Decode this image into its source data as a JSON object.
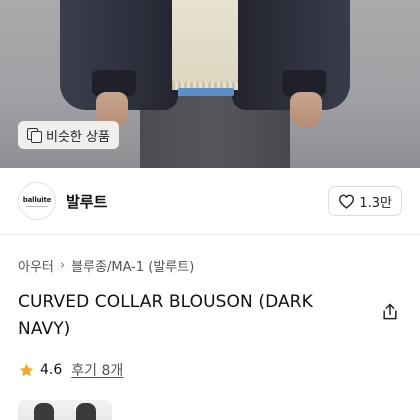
{
  "hero": {
    "similar_badge_label": "비슷한 상품",
    "similar_badge_icon": "copy-icon"
  },
  "shop": {
    "logo_text": "balluite",
    "name": "발루트",
    "like_count": "1.3만",
    "like_icon": "heart-icon"
  },
  "breadcrumb": {
    "items": [
      "아우터",
      "블루종/MA-1 (발루트)"
    ]
  },
  "product": {
    "title": "CURVED COLLAR BLOUSON (DARK NAVY)",
    "share_icon": "share-icon"
  },
  "rating": {
    "score": "4.6",
    "reviews_label": "후기 8개",
    "star_color": "#f5a623"
  }
}
